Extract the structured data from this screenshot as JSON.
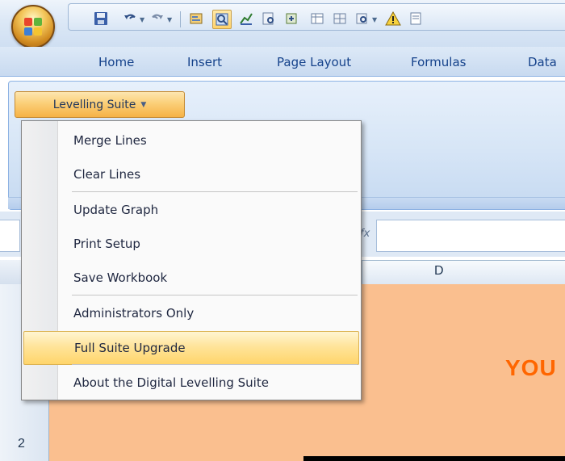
{
  "ribbon": {
    "tabs": [
      "Home",
      "Insert",
      "Page Layout",
      "Formulas",
      "Data"
    ],
    "suite_button_label": "Levelling Suite"
  },
  "menu": {
    "items": [
      "Merge Lines",
      "Clear Lines",
      "Update Graph",
      "Print Setup",
      "Save Workbook",
      "Administrators Only",
      "Full Suite Upgrade",
      "About the Digital Levelling Suite"
    ],
    "highlighted_index": 6
  },
  "sheet": {
    "column_header": "D",
    "row_label": "2",
    "banner_text": "YOU",
    "fill_color": "#fabf8f",
    "banner_color": "#ff6600"
  },
  "icons": {
    "quick_access": [
      "save-icon",
      "undo-icon",
      "redo-icon",
      "form-icon",
      "tools-icon",
      "chart-icon",
      "find-icon",
      "settings-icon",
      "table-icon",
      "grid-icon",
      "inspect-icon",
      "warning-icon",
      "sheet-icon"
    ]
  },
  "colors": {
    "ribbon_accent": "#15428b",
    "highlight": "#ffd56b",
    "suite_button": "#fbcf78"
  }
}
